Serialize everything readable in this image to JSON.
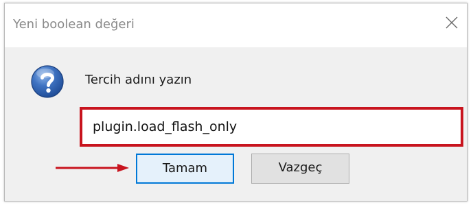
{
  "dialog": {
    "title": "Yeni boolean değeri",
    "prompt": "Tercih adını yazın",
    "input_value": "plugin.load_flash_only",
    "ok_label": "Tamam",
    "cancel_label": "Vazgeç"
  },
  "icons": {
    "close": "close-icon",
    "question": "question-icon",
    "arrow": "arrow-right-icon"
  },
  "colors": {
    "highlight_border": "#c8141e",
    "arrow": "#c8141e",
    "default_button_border": "#0078d7",
    "question_icon": "#2a5ca8"
  }
}
